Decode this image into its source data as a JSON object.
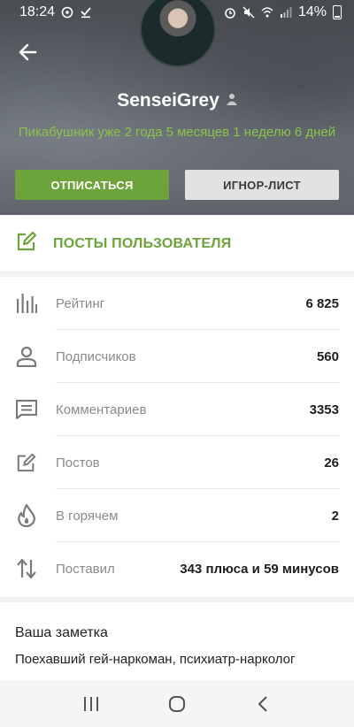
{
  "status_bar": {
    "time": "18:24",
    "battery": "14%"
  },
  "profile": {
    "username": "SenseiGrey",
    "tenure": "Пикабушник уже 2 года 5 месяцев 1 неделю 6 дней",
    "unsubscribe_label": "ОТПИСАТЬСЯ",
    "ignore_label": "ИГНОР-ЛИСТ"
  },
  "posts": {
    "label": "ПОСТЫ ПОЛЬЗОВАТЕЛЯ"
  },
  "stats": [
    {
      "icon": "bar-chart-icon",
      "label": "Рейтинг",
      "value": "6 825"
    },
    {
      "icon": "person-icon",
      "label": "Подписчиков",
      "value": "560"
    },
    {
      "icon": "comment-icon",
      "label": "Комментариев",
      "value": "3353"
    },
    {
      "icon": "edit-icon",
      "label": "Постов",
      "value": "26"
    },
    {
      "icon": "flame-icon",
      "label": "В горячем",
      "value": "2"
    },
    {
      "icon": "swap-vertical-icon",
      "label": "Поставил",
      "value": "343 плюса и 59 минусов"
    }
  ],
  "note": {
    "title": "Ваша заметка",
    "text": "Поехавший гей-наркоман, психиатр-нарколог"
  },
  "colors": {
    "accent": "#6ca33a",
    "tenure_text": "#8bc34a"
  }
}
